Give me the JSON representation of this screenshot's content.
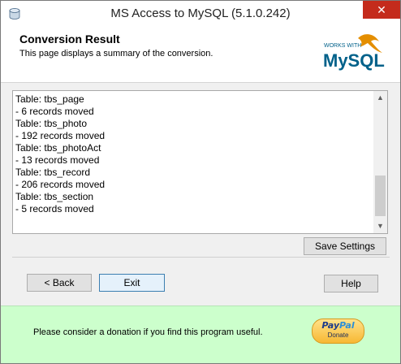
{
  "window": {
    "title": "MS Access to MySQL (5.1.0.242)",
    "close_glyph": "✕",
    "icon": "database-icon"
  },
  "header": {
    "title": "Conversion Result",
    "subtitle": "This page displays a summary of the conversion.",
    "logo_small": "WORKS WITH",
    "logo_big": "MySQL"
  },
  "log": {
    "lines": [
      "Table: tbs_page",
      "- 6 records moved",
      "Table: tbs_photo",
      "- 192 records moved",
      "Table: tbs_photoAct",
      "- 13 records moved",
      "Table: tbs_record",
      "- 206 records moved",
      "Table: tbs_section",
      "- 5 records moved"
    ],
    "scroll_up_glyph": "▲",
    "scroll_down_glyph": "▼"
  },
  "buttons": {
    "save_settings": "Save Settings",
    "back": "< Back",
    "exit": "Exit",
    "help": "Help"
  },
  "donate": {
    "text": "Please consider a donation if you find this program useful.",
    "paypal_pay": "Pay",
    "paypal_pal": "Pal",
    "paypal_donate": "Donate"
  },
  "colors": {
    "close_button": "#c42b1c",
    "donate_bar": "#ccffcc",
    "mysql_blue": "#00618a",
    "mysql_orange": "#e48e00"
  }
}
